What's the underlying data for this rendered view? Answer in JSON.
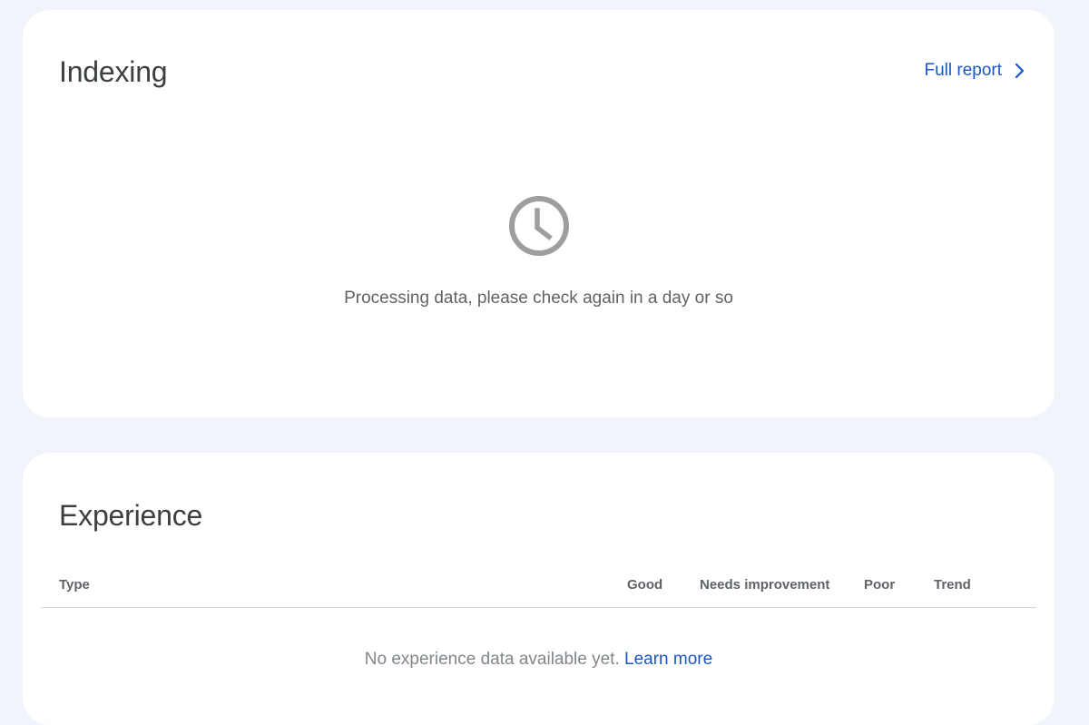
{
  "indexing": {
    "title": "Indexing",
    "full_report_label": "Full report",
    "full_report_icon": "chevron-right-icon",
    "status_icon": "clock-icon",
    "status_text": "Processing data, please check again in a day or so"
  },
  "experience": {
    "title": "Experience",
    "columns": [
      "Type",
      "Good",
      "Needs improvement",
      "Poor",
      "Trend"
    ],
    "empty_text": "No experience data available yet.",
    "learn_more_label": "Learn more"
  },
  "colors": {
    "background": "#f1f5fb",
    "card": "#ffffff",
    "link": "#1a56c4",
    "title": "#3c4043",
    "muted": "#5f6368",
    "icon": "#9e9e9e"
  }
}
